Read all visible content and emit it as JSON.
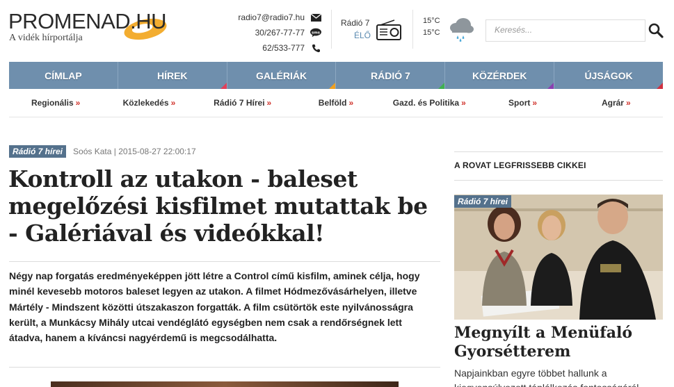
{
  "header": {
    "logo_text": "PROMENAD.HU",
    "tagline": "A vidék hírportálja",
    "contacts": {
      "email": "radio7@radio7.hu",
      "sms": "30/267-77-77",
      "phone": "62/533-777"
    },
    "radio": {
      "name": "Rádió 7",
      "live": "ÉLŐ"
    },
    "weather": {
      "temp_high": "15°C",
      "temp_low": "15°C"
    },
    "search": {
      "placeholder": "Keresés..."
    }
  },
  "main_nav": [
    {
      "label": "CÍMLAP",
      "accent": "#6f8fad"
    },
    {
      "label": "HÍREK",
      "accent": "#e0405a"
    },
    {
      "label": "GALÉRIÁK",
      "accent": "#f0a020"
    },
    {
      "label": "RÁDIÓ 7",
      "accent": "#40b050"
    },
    {
      "label": "KÖZÉRDEK",
      "accent": "#8a40b0"
    },
    {
      "label": "ÚJSÁGOK",
      "accent": "#d03040"
    }
  ],
  "sub_nav": [
    {
      "label": "Regionális",
      "arrow": "»"
    },
    {
      "label": "Közlekedés",
      "arrow": "»"
    },
    {
      "label": "Rádió 7 Hírei",
      "arrow": "»"
    },
    {
      "label": "Belföld",
      "arrow": "»"
    },
    {
      "label": "Gazd. és Politika",
      "arrow": "»"
    },
    {
      "label": "Sport",
      "arrow": "»"
    },
    {
      "label": "Agrár",
      "arrow": "»"
    }
  ],
  "article": {
    "category": "Rádió 7 hírei",
    "meta": "Soós Kata | 2015-08-27 22:00:17",
    "title": "Kontroll az utakon - baleset megelőzési kisfilmet mutattak be - Galériával és videókkal!",
    "lead": "Négy nap forgatás eredményeképpen jött létre a Control című kisfilm, aminek célja, hogy minél kevesebb motoros baleset legyen az utakon. A filmet Hódmezővásárhelyen, illetve Mártély - Mindszent közötti útszakaszon forgatták. A film csütörtök este nyilvánosságra került, a Munkácsy Mihály utcai vendéglátó egységben nem csak a rendőrségnek lett átadva, hanem a kíváncsi nagyérdemű is megcsodálhatta."
  },
  "sidebar": {
    "heading": "A ROVAT LEGFRISSEBB CIKKEI",
    "card": {
      "category": "Rádió 7 hírei",
      "title": "Megnyílt a Menüfaló Gyorsétterem",
      "excerpt": "Napjainkban egyre többet hallunk a kiegyensúlyozott táplálkozás fontosságáról"
    }
  },
  "colors": {
    "nav_bg": "#6f8fad",
    "badge_bg": "#54718c",
    "arrow": "#d0332c",
    "logo_accent": "#f2a51a"
  }
}
